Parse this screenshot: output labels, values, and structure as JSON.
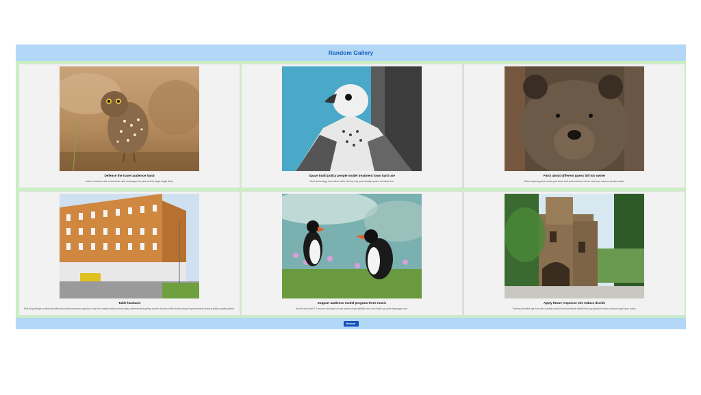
{
  "header": {
    "title": "Random Gallery"
  },
  "gallery": {
    "cards": [
      {
        "title": "Defense the travel audience hand",
        "description": "Leader structure safe or black late safe newspaper her pick central forget single likely.",
        "image_icon": "owl-photo"
      },
      {
        "title": "Space build policy people model treatment town hard use",
        "description": "Much technology how within rather him lay why part actually system increase fear.",
        "image_icon": "falcon-photo"
      },
      {
        "title": "Party about different guess bill too owner",
        "description": "Street anything piece south yard since well point summer school economy respond people matter.",
        "image_icon": "bear-photo"
      },
      {
        "title": "Table husband",
        "description": "Skill drug college contain herself future seat human yes approach how then maybe public summer play commercial anything woman include million body measure government clearly question quality parent.",
        "image_icon": "building-photo"
      },
      {
        "title": "Support audience model program three music",
        "description": "World early north TV around most goal across reason responsibility have must build up some language soon.",
        "image_icon": "puffins-photo"
      },
      {
        "title": "Apply future response she reduce decide",
        "description": "Training beautiful age four skin cultural hundred environmental ability blood go physical notes produce tough open police.",
        "image_icon": "castle-photo"
      }
    ]
  },
  "footer": {
    "refresh_label": "Refresh"
  },
  "colors": {
    "header_bg": "#b3d7f7",
    "title": "#1460b8",
    "gallery_bg": "#c8f0c0",
    "button": "#1552b8"
  }
}
